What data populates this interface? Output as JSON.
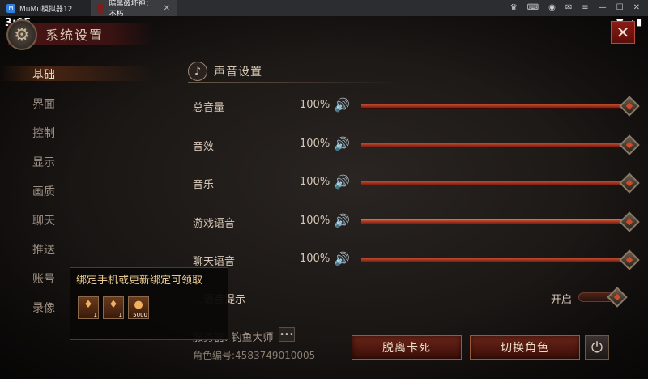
{
  "emulator": {
    "tabs": [
      {
        "label": "MuMu模拟器12"
      },
      {
        "label": "暗黑破坏神：不朽"
      }
    ]
  },
  "status": {
    "time": "3:05"
  },
  "header": {
    "title": "系统设置"
  },
  "sidebar": {
    "items": [
      {
        "label": "基础",
        "active": true
      },
      {
        "label": "界面"
      },
      {
        "label": "控制"
      },
      {
        "label": "显示"
      },
      {
        "label": "画质"
      },
      {
        "label": "聊天"
      },
      {
        "label": "推送"
      },
      {
        "label": "账号"
      },
      {
        "label": "录像"
      }
    ]
  },
  "sound": {
    "title": "声音设置",
    "rows": [
      {
        "label": "总音量",
        "value": "100%",
        "level": 1.0
      },
      {
        "label": "音效",
        "value": "100%",
        "level": 1.0
      },
      {
        "label": "音乐",
        "value": "100%",
        "level": 1.0
      },
      {
        "label": "游戏语音",
        "value": "100%",
        "level": 1.0
      },
      {
        "label": "聊天语音",
        "value": "100%",
        "level": 1.0
      }
    ],
    "toggle": {
      "label": "…语音提示",
      "state": "开启"
    }
  },
  "footer": {
    "server": "服务器: 钓鱼大师",
    "server_more": "•••",
    "role_id": "角色编号:4583749010005",
    "btn_unstuck": "脱离卡死",
    "btn_switch_role": "切换角色"
  },
  "popup": {
    "title": "绑定手机或更新绑定可领取",
    "rewards": [
      {
        "count": "1"
      },
      {
        "count": "1"
      },
      {
        "count": "5000"
      }
    ]
  },
  "colors": {
    "accent_red": "#c24a2e",
    "text_light": "#d6c8b8",
    "popup_title": "#e8c890"
  }
}
